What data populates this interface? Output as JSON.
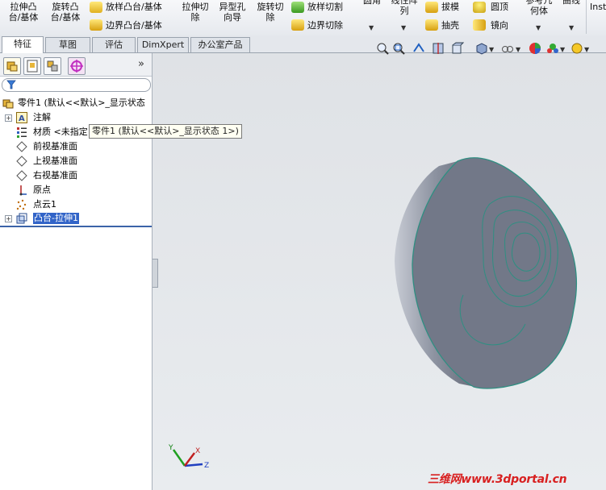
{
  "ribbon": {
    "extrude_boss": "拉伸凸\n台/基体",
    "revolve_boss": "旋转凸\n台/基体",
    "loft_boss": "放样凸台/基体",
    "boundary_boss": "边界凸台/基体",
    "extrude_cut": "拉伸切\n除",
    "hole_wizard": "异型孔\n向导",
    "revolve_cut": "旋转切\n除",
    "loft_cut": "放样切割",
    "boundary_cut": "边界切除",
    "fillet": "圆角",
    "linear_pattern": "线性阵\n列",
    "draft": "拔模",
    "shell": "抽壳",
    "dome": "圆顶",
    "mirror": "镜向",
    "ref_geometry": "参考几\n何体",
    "curves": "曲线",
    "instant3d": "Inst"
  },
  "tabs": [
    "特征",
    "草图",
    "评估",
    "DimXpert",
    "办公室产品"
  ],
  "tree": {
    "root": "零件1   (默认<<默认>_显示状态",
    "annotations": "注解",
    "material": "材质 <未指定",
    "front_plane": "前视基准面",
    "top_plane": "上视基准面",
    "right_plane": "右视基准面",
    "origin": "原点",
    "point_cloud": "点云1",
    "boss_extrude": "凸台-拉伸1",
    "expand_more": "»"
  },
  "tooltip": "零件1  (默认<<默认>_显示状态 1>)",
  "triad": {
    "x": "X",
    "y": "Y",
    "z": "Z"
  },
  "watermark": "三维网www.3dportal.cn",
  "colors": {
    "model_face": "#727888",
    "model_edge": "#2f8f82",
    "selection": "#3264c8"
  }
}
